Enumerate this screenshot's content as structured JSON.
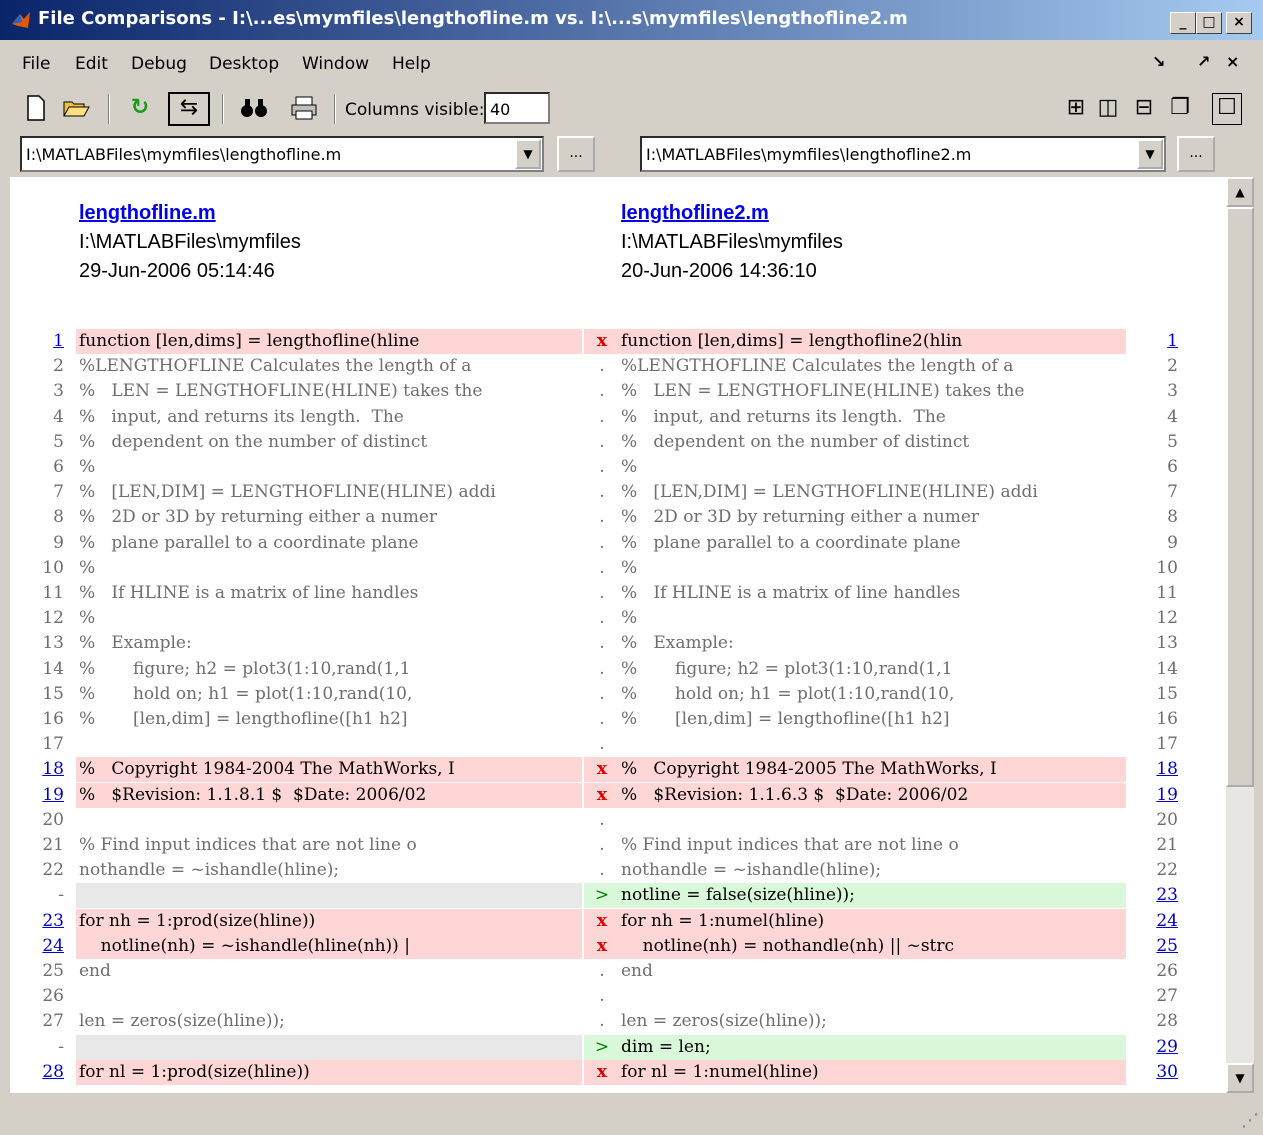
{
  "window": {
    "title": "File Comparisons - I:\\...es\\mymfiles\\lengthofline.m vs. I:\\...s\\mymfiles\\lengthofline2.m",
    "minimize": "_",
    "maximize": "□",
    "close": "×"
  },
  "menu": [
    "File",
    "Edit",
    "Debug",
    "Desktop",
    "Window",
    "Help"
  ],
  "menu_right": [
    "↘",
    "↗",
    "×"
  ],
  "toolbar": {
    "columns_label": "Columns visible:",
    "columns_value": "40"
  },
  "left_file": {
    "path": "I:\\MATLABFiles\\mymfiles\\lengthofline.m",
    "name": "lengthofline.m",
    "dir": "I:\\MATLABFiles\\mymfiles",
    "date": "29-Jun-2006 05:14:46"
  },
  "right_file": {
    "path": "I:\\MATLABFiles\\mymfiles\\lengthofline2.m",
    "name": "lengthofline2.m",
    "dir": "I:\\MATLABFiles\\mymfiles",
    "date": "20-Jun-2006 14:36:10"
  },
  "browse_label": "...",
  "rows": [
    {
      "type": "diff",
      "ln": "1",
      "lt": "function [len,dims] = lengthofline(hline",
      "m": "x",
      "rt": "function [len,dims] = lengthofline2(hlin",
      "rn": "1"
    },
    {
      "type": "same",
      "ln": "2",
      "lt": "%LENGTHOFLINE Calculates the length of a",
      "m": ".",
      "rt": "%LENGTHOFLINE Calculates the length of a",
      "rn": "2"
    },
    {
      "type": "same",
      "ln": "3",
      "lt": "%   LEN = LENGTHOFLINE(HLINE) takes the",
      "m": ".",
      "rt": "%   LEN = LENGTHOFLINE(HLINE) takes the",
      "rn": "3"
    },
    {
      "type": "same",
      "ln": "4",
      "lt": "%   input, and returns its length.  The",
      "m": ".",
      "rt": "%   input, and returns its length.  The",
      "rn": "4"
    },
    {
      "type": "same",
      "ln": "5",
      "lt": "%   dependent on the number of distinct",
      "m": ".",
      "rt": "%   dependent on the number of distinct",
      "rn": "5"
    },
    {
      "type": "same",
      "ln": "6",
      "lt": "%",
      "m": ".",
      "rt": "%",
      "rn": "6"
    },
    {
      "type": "same",
      "ln": "7",
      "lt": "%   [LEN,DIM] = LENGTHOFLINE(HLINE) addi",
      "m": ".",
      "rt": "%   [LEN,DIM] = LENGTHOFLINE(HLINE) addi",
      "rn": "7"
    },
    {
      "type": "same",
      "ln": "8",
      "lt": "%   2D or 3D by returning either a numer",
      "m": ".",
      "rt": "%   2D or 3D by returning either a numer",
      "rn": "8"
    },
    {
      "type": "same",
      "ln": "9",
      "lt": "%   plane parallel to a coordinate plane",
      "m": ".",
      "rt": "%   plane parallel to a coordinate plane",
      "rn": "9"
    },
    {
      "type": "same",
      "ln": "10",
      "lt": "%",
      "m": ".",
      "rt": "%",
      "rn": "10"
    },
    {
      "type": "same",
      "ln": "11",
      "lt": "%   If HLINE is a matrix of line handles",
      "m": ".",
      "rt": "%   If HLINE is a matrix of line handles",
      "rn": "11"
    },
    {
      "type": "same",
      "ln": "12",
      "lt": "%",
      "m": ".",
      "rt": "%",
      "rn": "12"
    },
    {
      "type": "same",
      "ln": "13",
      "lt": "%   Example:",
      "m": ".",
      "rt": "%   Example:",
      "rn": "13"
    },
    {
      "type": "same",
      "ln": "14",
      "lt": "%       figure; h2 = plot3(1:10,rand(1,1",
      "m": ".",
      "rt": "%       figure; h2 = plot3(1:10,rand(1,1",
      "rn": "14"
    },
    {
      "type": "same",
      "ln": "15",
      "lt": "%       hold on; h1 = plot(1:10,rand(10,",
      "m": ".",
      "rt": "%       hold on; h1 = plot(1:10,rand(10,",
      "rn": "15"
    },
    {
      "type": "same",
      "ln": "16",
      "lt": "%       [len,dim] = lengthofline([h1 h2]",
      "m": ".",
      "rt": "%       [len,dim] = lengthofline([h1 h2]",
      "rn": "16"
    },
    {
      "type": "same",
      "ln": "17",
      "lt": "",
      "m": ".",
      "rt": "",
      "rn": "17"
    },
    {
      "type": "diff",
      "ln": "18",
      "lt": "%   Copyright 1984-2004 The MathWorks, I",
      "m": "x",
      "rt": "%   Copyright 1984-2005 The MathWorks, I",
      "rn": "18"
    },
    {
      "type": "diff",
      "ln": "19",
      "lt": "%   $Revision: 1.1.8.1 $  $Date: 2006/02",
      "m": "x",
      "rt": "%   $Revision: 1.1.6.3 $  $Date: 2006/02",
      "rn": "19"
    },
    {
      "type": "same",
      "ln": "20",
      "lt": "",
      "m": ".",
      "rt": "",
      "rn": "20"
    },
    {
      "type": "same",
      "ln": "21",
      "lt": "% Find input indices that are not line o",
      "m": ".",
      "rt": "% Find input indices that are not line o",
      "rn": "21"
    },
    {
      "type": "same",
      "ln": "22",
      "lt": "nothandle = ~ishandle(hline);",
      "m": ".",
      "rt": "nothandle = ~ishandle(hline);",
      "rn": "22"
    },
    {
      "type": "ins",
      "ln": "-",
      "lt": "",
      "m": ">",
      "rt": "notline = false(size(hline));",
      "rn": "23"
    },
    {
      "type": "diff",
      "ln": "23",
      "lt": "for nh = 1:prod(size(hline))",
      "m": "x",
      "rt": "for nh = 1:numel(hline)",
      "rn": "24"
    },
    {
      "type": "diff",
      "ln": "24",
      "lt": "    notline(nh) = ~ishandle(hline(nh)) |",
      "m": "x",
      "rt": "    notline(nh) = nothandle(nh) || ~strc",
      "rn": "25"
    },
    {
      "type": "same",
      "ln": "25",
      "lt": "end",
      "m": ".",
      "rt": "end",
      "rn": "26"
    },
    {
      "type": "same",
      "ln": "26",
      "lt": "",
      "m": ".",
      "rt": "",
      "rn": "27"
    },
    {
      "type": "same",
      "ln": "27",
      "lt": "len = zeros(size(hline));",
      "m": ".",
      "rt": "len = zeros(size(hline));",
      "rn": "28"
    },
    {
      "type": "ins",
      "ln": "-",
      "lt": "",
      "m": ">",
      "rt": "dim = len;",
      "rn": "29"
    },
    {
      "type": "diff",
      "ln": "28",
      "lt": "for nl = 1:prod(size(hline))",
      "m": "x",
      "rt": "for nl = 1:numel(hline)",
      "rn": "30"
    }
  ]
}
